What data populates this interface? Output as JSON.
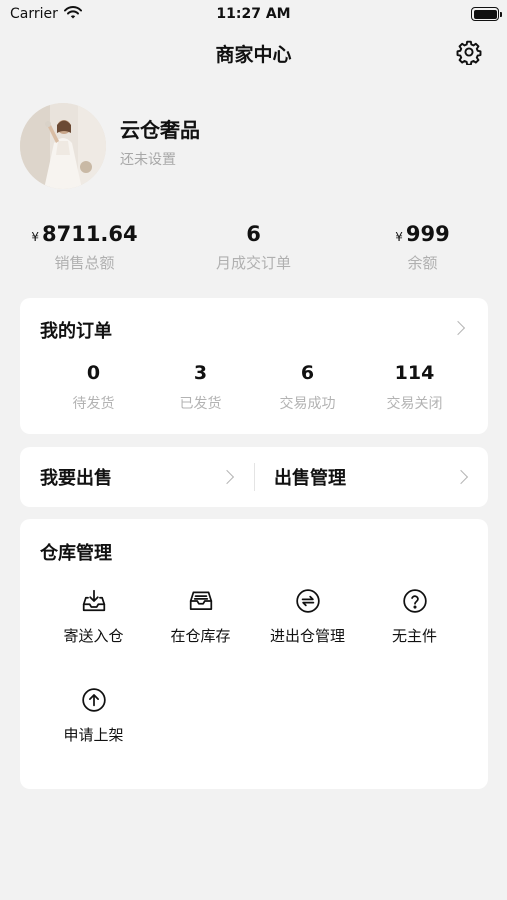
{
  "status_bar": {
    "carrier": "Carrier",
    "time": "11:27 AM"
  },
  "nav": {
    "title": "商家中心",
    "settings_icon": "gear-icon"
  },
  "profile": {
    "name": "云仓奢品",
    "subtitle": "还未设置"
  },
  "stats": [
    {
      "currency": "¥",
      "value": "8711.64",
      "label": "销售总额"
    },
    {
      "currency": "",
      "value": "6",
      "label": "月成交订单"
    },
    {
      "currency": "¥",
      "value": "999",
      "label": "余额"
    }
  ],
  "orders": {
    "title": "我的订单",
    "items": [
      {
        "value": "0",
        "label": "待发货"
      },
      {
        "value": "3",
        "label": "已发货"
      },
      {
        "value": "6",
        "label": "交易成功"
      },
      {
        "value": "114",
        "label": "交易关闭"
      }
    ]
  },
  "sell": {
    "sell_label": "我要出售",
    "manage_label": "出售管理"
  },
  "warehouse": {
    "title": "仓库管理",
    "items": [
      {
        "label": "寄送入仓",
        "icon": "inbox-download-icon"
      },
      {
        "label": "在仓库存",
        "icon": "tray-icon"
      },
      {
        "label": "进出仓管理",
        "icon": "exchange-icon"
      },
      {
        "label": "无主件",
        "icon": "question-icon"
      },
      {
        "label": "申请上架",
        "icon": "arrow-up-circle-icon"
      }
    ]
  }
}
